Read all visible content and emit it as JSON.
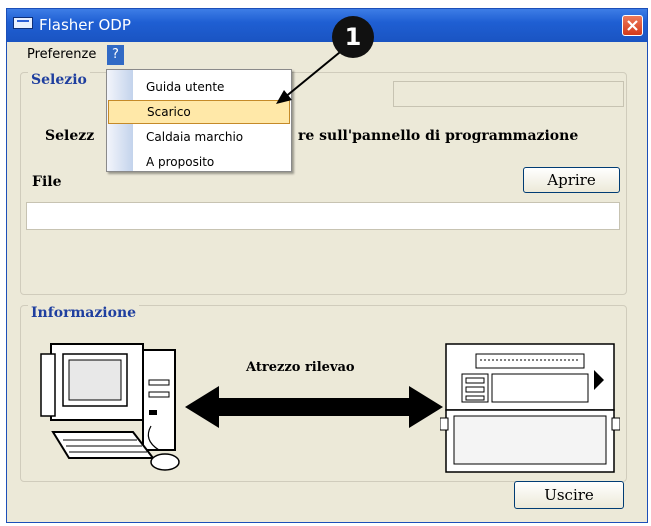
{
  "window": {
    "title": "Flasher ODP"
  },
  "menubar": {
    "items": [
      "Preferenze",
      "?"
    ]
  },
  "help_menu": {
    "items": [
      "Guida utente",
      "Scarico",
      "Caldaia marchio",
      "A proposito"
    ],
    "selected": "Scarico"
  },
  "selection_group": {
    "legend": "Selezio",
    "instruction_start": "Selezz",
    "instruction_end": "re sull'pannello di programmazione",
    "file_label": "File",
    "file_value": "",
    "open_button": "Aprire"
  },
  "info_group": {
    "legend": "Informazione",
    "tool_label": "Atrezzo rilevao"
  },
  "footer": {
    "exit_button": "Uscire"
  },
  "callout": {
    "number": "1"
  },
  "colors": {
    "titlebar": "#1f5fd3",
    "menu_highlight": "#316ac5",
    "dropdown_selection": "#ffe8a8",
    "legend_text": "#1f3f9f"
  }
}
